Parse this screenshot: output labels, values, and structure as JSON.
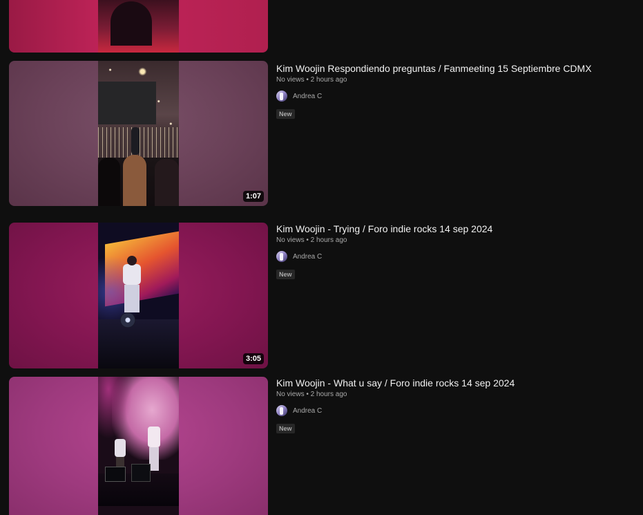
{
  "videos": [
    {
      "title": "",
      "duration": "",
      "views": "",
      "time": "",
      "channel": "",
      "badge": ""
    },
    {
      "title": "Kim Woojin Respondiendo preguntas / Fanmeeting 15 Septiembre CDMX",
      "duration": "1:07",
      "views": "No views",
      "time": "2 hours ago",
      "channel": "Andrea C",
      "badge": "New"
    },
    {
      "title": "Kim Woojin - Trying / Foro indie rocks 14 sep 2024",
      "duration": "3:05",
      "views": "No views",
      "time": "2 hours ago",
      "channel": "Andrea C",
      "badge": "New"
    },
    {
      "title": "Kim Woojin - What u say / Foro indie rocks 14 sep 2024",
      "duration": "",
      "views": "No views",
      "time": "2 hours ago",
      "channel": "Andrea C",
      "badge": "New"
    }
  ],
  "separator": " • ",
  "colors": {
    "background": "#0f0f0f",
    "title": "#f1f1f1",
    "secondary": "#aaaaaa",
    "badge_bg": "#272727"
  }
}
